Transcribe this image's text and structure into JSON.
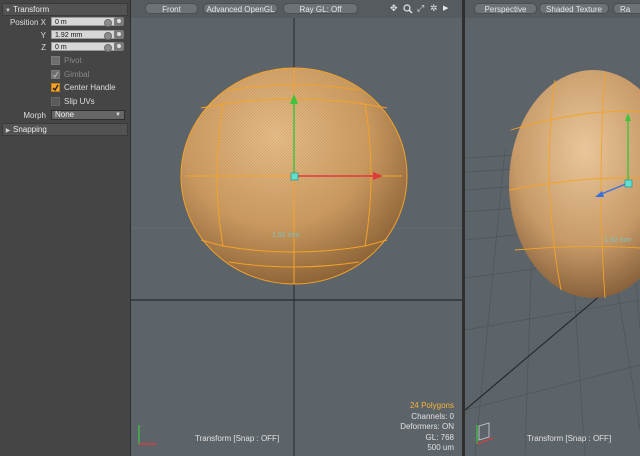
{
  "panel": {
    "transform_section": "Transform",
    "position": {
      "label_x": "Position X",
      "label_y": "Y",
      "label_z": "Z",
      "x": "0 m",
      "y": "1.92 mm",
      "z": "0 m"
    },
    "checkboxes": [
      {
        "label": "Pivot",
        "checked": false,
        "enabled": false
      },
      {
        "label": "Gimbal",
        "checked": true,
        "enabled": false
      },
      {
        "label": "Center Handle",
        "checked": true,
        "enabled": true
      },
      {
        "label": "Slip UVs",
        "checked": false,
        "enabled": true
      }
    ],
    "morph_label": "Morph",
    "morph_value": "None",
    "snapping_section": "Snapping"
  },
  "front_viewport": {
    "view_label": "Front",
    "shading_label": "Advanced OpenGL",
    "raygl_label": "Ray GL: Off",
    "icons": [
      "move-icon",
      "zoom-icon",
      "maximize-icon",
      "gear-icon",
      "expand-arrow-icon"
    ],
    "measure_label": "1.92 mm",
    "stats": {
      "polygons": "24 Polygons",
      "channels": "Channels: 0",
      "deformers": "Deformers: ON",
      "gl": "GL: 768",
      "scale": "500 um"
    },
    "tool_status": "Transform  [Snap : OFF]"
  },
  "persp_viewport": {
    "view_label": "Perspective",
    "shading_label": "Shaded Texture",
    "raygl_label": "Ra",
    "measure_label": "1.92 mm",
    "tool_status": "Transform  [Snap : OFF]"
  },
  "colors": {
    "viewport_bg": "#5d6469",
    "selection_accent": "#f2a32a",
    "x_axis": "#e03a3a",
    "y_axis": "#3ec43e",
    "z_axis": "#3a6fe0"
  }
}
